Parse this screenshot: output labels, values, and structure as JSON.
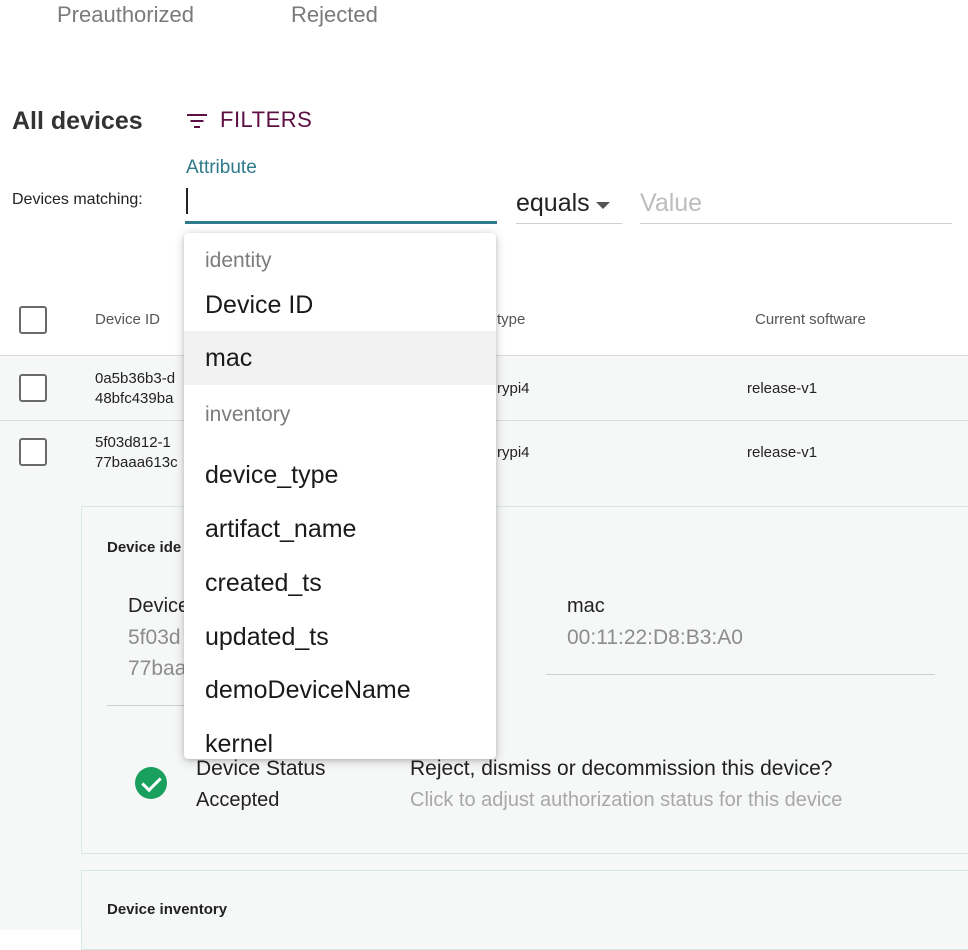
{
  "tabs": [
    "Preauthorized",
    "Rejected"
  ],
  "header": {
    "title": "All devices",
    "filters_label": "FILTERS"
  },
  "filter": {
    "matching_label": "Devices matching:",
    "attribute_label": "Attribute",
    "attribute_value": "",
    "operator": "equals",
    "value_placeholder": "Value"
  },
  "table": {
    "columns": [
      "Device ID",
      "type",
      "Current software"
    ],
    "rows": [
      {
        "id_line1": "0a5b36b3-d",
        "id_line2": "48bfc439ba",
        "type": "rypi4",
        "software": "release-v1"
      },
      {
        "id_line1": "5f03d812-1",
        "id_line2": "77baaa613c",
        "type": "rypi4",
        "software": "release-v1"
      }
    ]
  },
  "details": {
    "identity_title": "Device ide",
    "device_field_label": "Device",
    "device_field_value_line1": "5f03d",
    "device_field_value_line2": "77baa",
    "mac_label": "mac",
    "mac_value": "00:11:22:D8:B3:A0",
    "status_label": "Device Status",
    "status_value": "Accepted",
    "reject_title": "Reject, dismiss or decommission this device?",
    "reject_hint": "Click to adjust authorization status for this device",
    "inventory_title": "Device inventory"
  },
  "dropdown": {
    "groups": [
      {
        "label": "identity",
        "items": [
          "Device ID",
          "mac"
        ]
      },
      {
        "label": "inventory",
        "items": [
          "device_type",
          "artifact_name",
          "created_ts",
          "updated_ts",
          "demoDeviceName",
          "kernel"
        ]
      }
    ],
    "highlighted": "mac"
  },
  "colors": {
    "accent": "#2c7a8a",
    "brand": "#5d0f43",
    "status_ok": "#19a05f"
  },
  "icons": [
    "filter-icon",
    "check-circle-icon",
    "caret-down-icon"
  ]
}
